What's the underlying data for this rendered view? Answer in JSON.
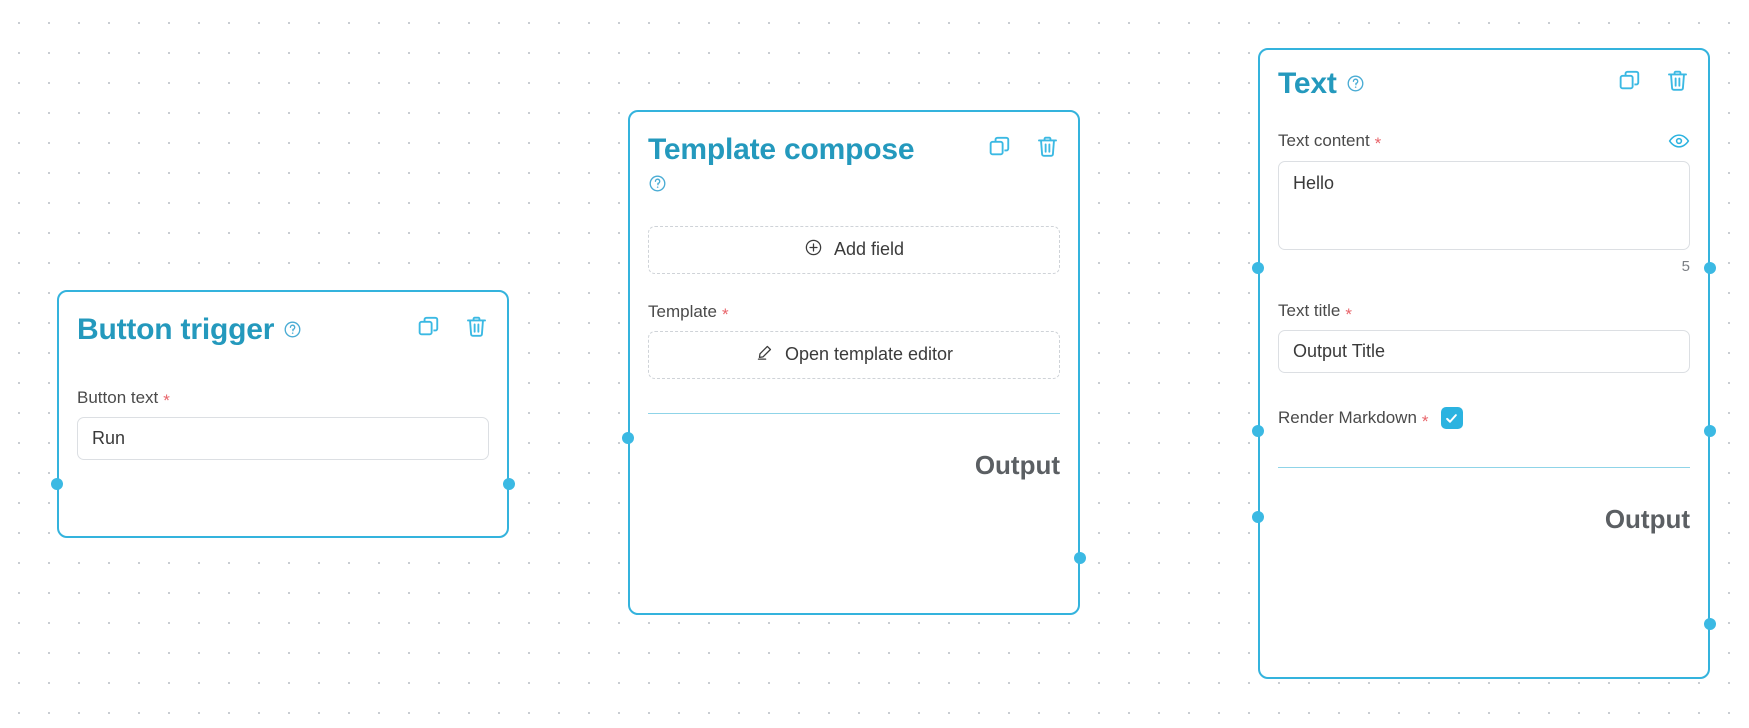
{
  "canvas": {
    "background_color": "#ffffff",
    "grid_dot_color": "#c9cdd2",
    "accent_color": "#34b3dd",
    "title_color": "#2499bd",
    "required_color": "#e8646a"
  },
  "nodes": [
    {
      "id": "button-trigger",
      "title": "Button trigger",
      "help_icon": "question-circle-icon",
      "actions": [
        {
          "name": "duplicate-icon",
          "label": "Duplicate"
        },
        {
          "name": "delete-icon",
          "label": "Delete"
        }
      ],
      "fields": [
        {
          "label": "Button text",
          "required": "*",
          "type": "text",
          "value": "Run"
        }
      ]
    },
    {
      "id": "template-compose",
      "title": "Template compose",
      "help_icon": "question-circle-icon",
      "actions": [
        {
          "name": "duplicate-icon",
          "label": "Duplicate"
        },
        {
          "name": "delete-icon",
          "label": "Delete"
        }
      ],
      "add_field_button": {
        "label": "Add field",
        "icon": "plus-circle-icon"
      },
      "fields": [
        {
          "label": "Template",
          "required": "*",
          "type": "button",
          "button_label": "Open template editor",
          "button_icon": "pencil-icon"
        }
      ],
      "output_label": "Output"
    },
    {
      "id": "text",
      "title": "Text",
      "help_icon": "question-circle-icon",
      "actions": [
        {
          "name": "duplicate-icon",
          "label": "Duplicate"
        },
        {
          "name": "delete-icon",
          "label": "Delete"
        }
      ],
      "fields": [
        {
          "label": "Text content",
          "required": "*",
          "type": "textarea",
          "value": "Hello",
          "char_count": "5",
          "preview_icon": "eye-icon"
        },
        {
          "label": "Text title",
          "required": "*",
          "type": "text",
          "value": "Output Title"
        },
        {
          "label": "Render Markdown",
          "required": "*",
          "type": "checkbox",
          "checked": true
        }
      ],
      "output_label": "Output"
    }
  ]
}
